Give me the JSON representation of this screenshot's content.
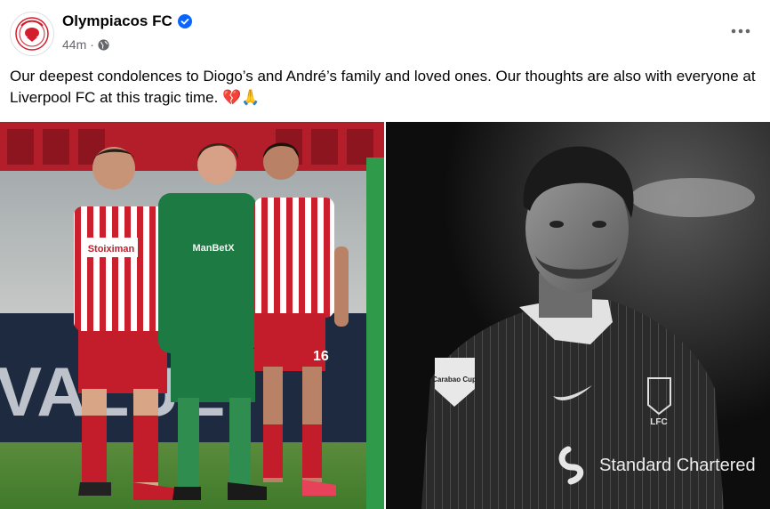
{
  "post": {
    "author": "Olympiacos FC",
    "time": "44m",
    "separator": "·",
    "text": "Our deepest condolences to Diogo’s and André’s family and loved ones. Our thoughts are also with everyone at Liverpool FC at this tragic time. 💔🙏",
    "icons": {
      "verified": "verified-badge-icon",
      "audience": "globe-icon",
      "more": "more-options-icon"
    }
  },
  "photos": {
    "left": {
      "banner_text": "VALUE ",
      "jersey_sponsor_red": "Stoiximan",
      "jersey_sponsor_green": "ManBetX",
      "jersey_number_red": "16"
    },
    "right": {
      "sponsor": "Standard Chartered",
      "badge": "LFC",
      "cup_patch": "Carabao Cup"
    }
  },
  "colors": {
    "verified": "#0866ff",
    "meta": "#65676b",
    "text": "#050505"
  }
}
